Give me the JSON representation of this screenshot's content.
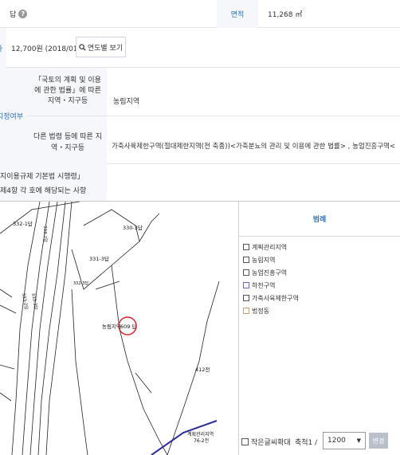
{
  "land": {
    "jimok_value": "답",
    "area_label": "면적",
    "area_value": "11,268 ㎡"
  },
  "price": {
    "value": "12,700원 (2018/01)",
    "button_label": "연도별 보기"
  },
  "zone": {
    "side_label": "지정여부",
    "law1_label": "「국토의 계획 및 이용에 관한 법률」에 따른 지역・지구등",
    "law1_value": "농림지역",
    "law2_label": "다른 법령 등에 따른 지역・지구등",
    "law2_value": "가축사육제한구역(절대제한지역(전 축종))<가축분뇨의 관리 및 이용에 관한 법률> , 농업진흥구역<"
  },
  "regulation": {
    "label_line1": "지이용규제 기본법 시행령」",
    "label_line2": "제4항 각 호에 해당되는 사항"
  },
  "map": {
    "labels": [
      "332-1답",
      "330-3답",
      "331-3답",
      "332-3답",
      "333-1답",
      "333-2답",
      "333-3답",
      "농림지역",
      "609 답",
      "412전",
      "계획관리지역",
      "76-2전"
    ],
    "marker_color": "#d9242a"
  },
  "legend": {
    "title": "범례",
    "items": [
      {
        "label": "계획관리지역",
        "color": "#555555"
      },
      {
        "label": "농림지역",
        "color": "#555555"
      },
      {
        "label": "농업진흥구역",
        "color": "#555555"
      },
      {
        "label": "하천구역",
        "color": "#6a6ac8"
      },
      {
        "label": "가축사육제한구역",
        "color": "#555555"
      },
      {
        "label": "법정동",
        "color": "#c9a26b"
      }
    ]
  },
  "controls": {
    "bigtext_label": "작은글씨확대",
    "scale_label": "축척1 /",
    "scale_value": "1200",
    "change_label": "변경"
  }
}
